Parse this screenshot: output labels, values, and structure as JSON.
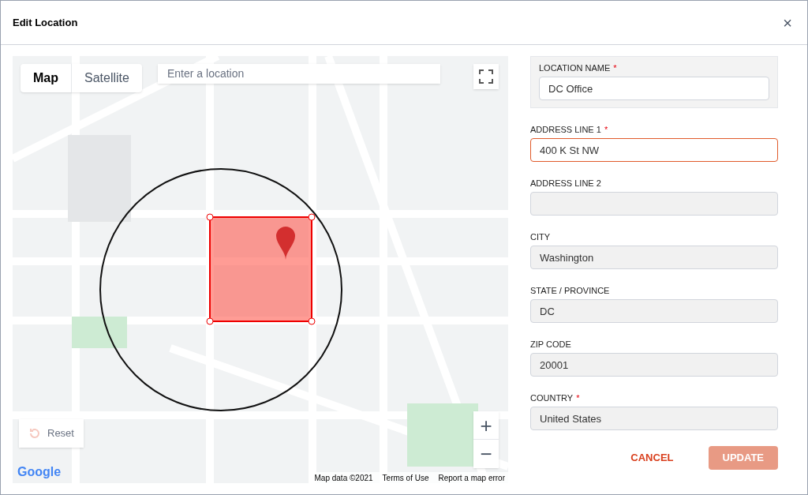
{
  "dialog": {
    "title": "Edit Location",
    "close": "×"
  },
  "map": {
    "tabs": [
      {
        "label": "Map",
        "selected": true
      },
      {
        "label": "Satellite",
        "selected": false
      }
    ],
    "search": {
      "placeholder": "Enter a location"
    },
    "zoom": {
      "in": "+",
      "out": "−"
    },
    "reset": {
      "label": "Reset",
      "disabled": true
    },
    "logo": "Google",
    "footer": [
      "Map data ©2021",
      "Terms of Use",
      "Report a map error"
    ]
  },
  "fields": [
    {
      "label": "LOCATION NAME",
      "required_mark": "*",
      "value": "DC Office",
      "highlighted": true,
      "invalid": false,
      "disabled": false
    },
    {
      "label": "ADDRESS LINE 1",
      "required_mark": "*",
      "value": "400 K St NW",
      "highlighted": false,
      "invalid": true,
      "disabled": false
    },
    {
      "label": "ADDRESS LINE 2",
      "highlighted": false,
      "invalid": false,
      "disabled": true
    },
    {
      "label": "CITY",
      "value": "Washington",
      "highlighted": false,
      "invalid": false,
      "disabled": true
    },
    {
      "label": "STATE / PROVINCE",
      "value": "DC",
      "highlighted": false,
      "invalid": false,
      "disabled": true
    },
    {
      "label": "ZIP CODE",
      "value": "20001",
      "highlighted": false,
      "invalid": false,
      "disabled": true
    },
    {
      "label": "COUNTRY",
      "required_mark": "*",
      "value": "United States",
      "highlighted": false,
      "invalid": false,
      "disabled": true
    }
  ],
  "buttons": [
    {
      "kind": "text",
      "label": "CANCEL",
      "disabled": false
    },
    {
      "kind": "filled",
      "label": "UPDATE",
      "disabled": true
    }
  ]
}
